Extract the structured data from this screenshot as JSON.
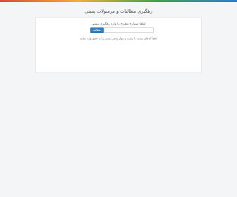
{
  "header": {
    "title": "رهگیری مطالبات و مرسولات پستی"
  },
  "tracking": {
    "prompt": "لطفا شماره مطرح را وارد رهگیری پستی",
    "submit_label": "مطالبه",
    "input_value": "",
    "hint": "لطفاً کدهای بیست یا بیست و چهار رقمی پستی را به دقیق وارد نمایید"
  },
  "colors": {
    "accent": "#2f7fc1",
    "background": "#f4f5f7"
  }
}
